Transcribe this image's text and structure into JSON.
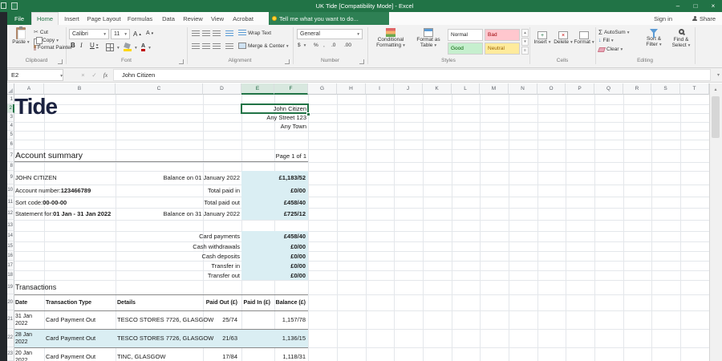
{
  "colors": {
    "accent_green": "#217346",
    "highlight_blue": "#daeef3",
    "logo_navy": "#1b2240",
    "style_bad": "#ffc7ce",
    "style_good": "#c6efce",
    "style_neutral": "#ffeb9c"
  },
  "icons": {
    "dropdown": "▾",
    "minimize": "–",
    "maximize": "□",
    "close": "×",
    "cancel": "×",
    "check": "✓",
    "fx": "fx",
    "scissors": "✂",
    "sum": "Σ",
    "fill_arrow": "↓",
    "up_arrow": "▴",
    "down_arrow": "▾",
    "more": "≡"
  },
  "window": {
    "title": "UK Tide  [Compatibility Mode] - Excel"
  },
  "tabs": {
    "file": "File",
    "items": [
      "Home",
      "Insert",
      "Page Layout",
      "Formulas",
      "Data",
      "Review",
      "View",
      "Acrobat"
    ],
    "tell_me": "Tell me what you want to do...",
    "sign_in": "Sign in",
    "share": "Share"
  },
  "ribbon": {
    "clipboard": {
      "label": "Clipboard",
      "paste": "Paste",
      "cut": "Cut",
      "copy": "Copy",
      "format_painter": "Format Painter"
    },
    "font": {
      "label": "Font",
      "family": "Calibri",
      "size": "11",
      "bold": "B",
      "italic": "I",
      "underline": "U",
      "grow": "A",
      "shrink": "A"
    },
    "alignment": {
      "label": "Alignment",
      "wrap": "Wrap Text",
      "merge": "Merge & Center"
    },
    "number": {
      "label": "Number",
      "format": "General",
      "currency": "$",
      "percent": "%",
      "comma": ",",
      "inc_dec": ".0",
      "dec_dec": ".00"
    },
    "styles": {
      "label": "Styles",
      "conditional": "Conditional Formatting",
      "format_table": "Format as Table",
      "tiles": [
        "Normal",
        "Bad",
        "Good",
        "Neutral"
      ]
    },
    "cells": {
      "label": "Cells",
      "insert": "Insert",
      "delete": "Delete",
      "format": "Format"
    },
    "editing": {
      "label": "Editing",
      "autosum": "AutoSum",
      "fill": "Fill",
      "clear": "Clear",
      "sort": "Sort & Filter",
      "find": "Find & Select"
    }
  },
  "formula_bar": {
    "name_box": "E2",
    "formula": "John Citizen"
  },
  "grid": {
    "columns": [
      "A",
      "B",
      "C",
      "D",
      "E",
      "F",
      "G",
      "H",
      "I",
      "J",
      "K",
      "L",
      "M",
      "N",
      "O",
      "P",
      "Q",
      "R",
      "S",
      "T"
    ],
    "rows": [
      "1",
      "2",
      "3",
      "4",
      "5",
      "6",
      "7",
      "8",
      "9",
      "10",
      "11",
      "12",
      "13",
      "14",
      "15",
      "16",
      "17",
      "18",
      "19",
      "20",
      "21",
      "22",
      "23"
    ]
  },
  "sheet": {
    "logo": "Tide",
    "recipient": {
      "name": "John Citizen",
      "street": "Any Street 123",
      "town": "Any Town"
    },
    "summary_title": "Account summary",
    "page": "Page 1 of 1",
    "account": [
      {
        "left": "JOHN CITIZEN",
        "left_bold": "",
        "label": "Balance on 01 January 2022",
        "value": "£1,183/52"
      },
      {
        "left": "Account number: ",
        "left_bold": "123466789",
        "label": "Total paid in",
        "value": "£0/00"
      },
      {
        "left": "Sort code: ",
        "left_bold": "00-00-00",
        "label": "Total paid out",
        "value": "£458/40"
      },
      {
        "left": "Statement for: ",
        "left_bold": "01 Jan - 31 Jan 2022",
        "label": "Balance on 31 January 2022",
        "value": "£725/12"
      }
    ],
    "breakdown": [
      {
        "label": "Card payments",
        "value": "£458/40"
      },
      {
        "label": "Cash withdrawals",
        "value": "£0/00"
      },
      {
        "label": "Cash deposits",
        "value": "£0/00"
      },
      {
        "label": "Transfer in",
        "value": "£0/00"
      },
      {
        "label": "Transfer out",
        "value": "£0/00"
      }
    ],
    "transactions_title": "Transactions",
    "table": {
      "headers": [
        "Date",
        "Transaction Type",
        "Details",
        "Paid Out (£)",
        "Paid In (£)",
        "Balance (£)"
      ],
      "rows": [
        {
          "date": "31 Jan 2022",
          "type": "Card Payment Out",
          "details": "TESCO STORES 7726, GLASGOW",
          "paid_out": "25/74",
          "paid_in": "",
          "balance": "1,157/78"
        },
        {
          "date": "28 Jan 2022",
          "type": "Card Payment Out",
          "details": "TESCO STORES 7726, GLASGOW",
          "paid_out": "21/63",
          "paid_in": "",
          "balance": "1,136/15"
        },
        {
          "date": "20 Jan 2022",
          "type": "Card Payment Out",
          "details": "TINC, GLASGOW",
          "paid_out": "17/84",
          "paid_in": "",
          "balance": "1,118/31"
        }
      ]
    }
  }
}
